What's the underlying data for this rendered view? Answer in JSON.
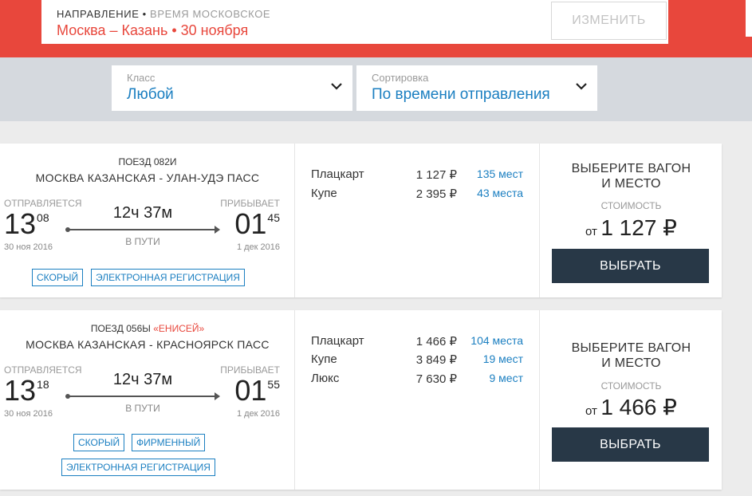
{
  "header": {
    "direction_label": "НАПРАВЛЕНИЕ",
    "separator": " • ",
    "timezone_label": "ВРЕМЯ МОСКОВСКОЕ",
    "route_title": "Москва – Казань • 30 ноября",
    "change_button": "ИЗМЕНИТЬ",
    "accent_color": "#e8473c"
  },
  "filters": {
    "class": {
      "label": "Класс",
      "value": "Любой",
      "icon": "chevron-down-icon"
    },
    "sort": {
      "label": "Сортировка",
      "value": "По времени отправления",
      "icon": "chevron-down-icon"
    }
  },
  "trains": [
    {
      "number": "ПОЕЗД 082И",
      "brand": "",
      "route": "МОСКВА КАЗАНСКАЯ - УЛАН-УДЭ ПАСС",
      "departs_label": "ОТПРАВЛЯЕТСЯ",
      "departs_hh": "13",
      "departs_mm": "08",
      "departs_date": "30 ноя 2016",
      "duration": "12ч 37м",
      "in_way_label": "В ПУТИ",
      "arrives_label": "ПРИБЫВАЕТ",
      "arrives_hh": "01",
      "arrives_mm": "45",
      "arrives_date": "1 дек 2016",
      "tags": [
        "СКОРЫЙ",
        "ЭЛЕКТРОННАЯ РЕГИСТРАЦИЯ"
      ],
      "seats": [
        {
          "type": "Плацкарт",
          "price": "1 127 ₽",
          "available": "135 мест"
        },
        {
          "type": "Купе",
          "price": "2 395 ₽",
          "available": "43 места"
        }
      ],
      "choose_line1": "ВЫБЕРИТЕ ВАГОН",
      "choose_line2": "И МЕСТО",
      "cost_label": "СТОИМОСТЬ",
      "cost_from": "от",
      "cost_amount": "1 127 ₽",
      "select_button": "ВЫБРАТЬ"
    },
    {
      "number": "ПОЕЗД 056Ы",
      "brand": "«ЕНИСЕЙ»",
      "route": "МОСКВА КАЗАНСКАЯ - КРАСНОЯРСК ПАСС",
      "departs_label": "ОТПРАВЛЯЕТСЯ",
      "departs_hh": "13",
      "departs_mm": "18",
      "departs_date": "30 ноя 2016",
      "duration": "12ч 37м",
      "in_way_label": "В ПУТИ",
      "arrives_label": "ПРИБЫВАЕТ",
      "arrives_hh": "01",
      "arrives_mm": "55",
      "arrives_date": "1 дек 2016",
      "tags": [
        "СКОРЫЙ",
        "ФИРМЕННЫЙ",
        "ЭЛЕКТРОННАЯ РЕГИСТРАЦИЯ"
      ],
      "seats": [
        {
          "type": "Плацкарт",
          "price": "1 466 ₽",
          "available": "104 места"
        },
        {
          "type": "Купе",
          "price": "3 849 ₽",
          "available": "19 мест"
        },
        {
          "type": "Люкс",
          "price": "7 630 ₽",
          "available": "9 мест"
        }
      ],
      "choose_line1": "ВЫБЕРИТЕ ВАГОН",
      "choose_line2": "И МЕСТО",
      "cost_label": "СТОИМОСТЬ",
      "cost_from": "от",
      "cost_amount": "1 466 ₽",
      "select_button": "ВЫБРАТЬ"
    }
  ]
}
